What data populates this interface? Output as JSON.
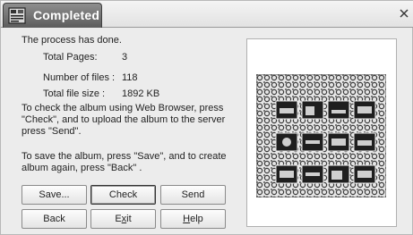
{
  "window": {
    "title": "Completed"
  },
  "message": {
    "status": "The process has done.",
    "total_pages_label": "Total Pages:",
    "total_pages_value": "3",
    "number_of_files_label": "Number of files :",
    "number_of_files_value": "118",
    "total_file_size_label": "Total file size :",
    "total_file_size_value": "1892 KB",
    "check_instructions": "To check the album using Web Browser, press\n\"Check\", and to upload the album to the server\npress \"Send\".",
    "save_instructions": "To save the album, press \"Save\", and to create\nalbum again, press \"Back\" ."
  },
  "buttons": {
    "save": "Save...",
    "check": "Check",
    "send": "Send",
    "back": "Back",
    "exit_mnemonic": "x",
    "exit_prefix": "E",
    "exit_suffix": "it",
    "help_mnemonic": "H",
    "help_suffix": "elp"
  },
  "icons": {
    "app": "album-icon",
    "close": "close-icon"
  },
  "colors": {
    "title_tab": "#6e6e6e",
    "title_text": "#ffffff",
    "window_bg": "#ececec",
    "preview_bg": "#ffffff"
  }
}
